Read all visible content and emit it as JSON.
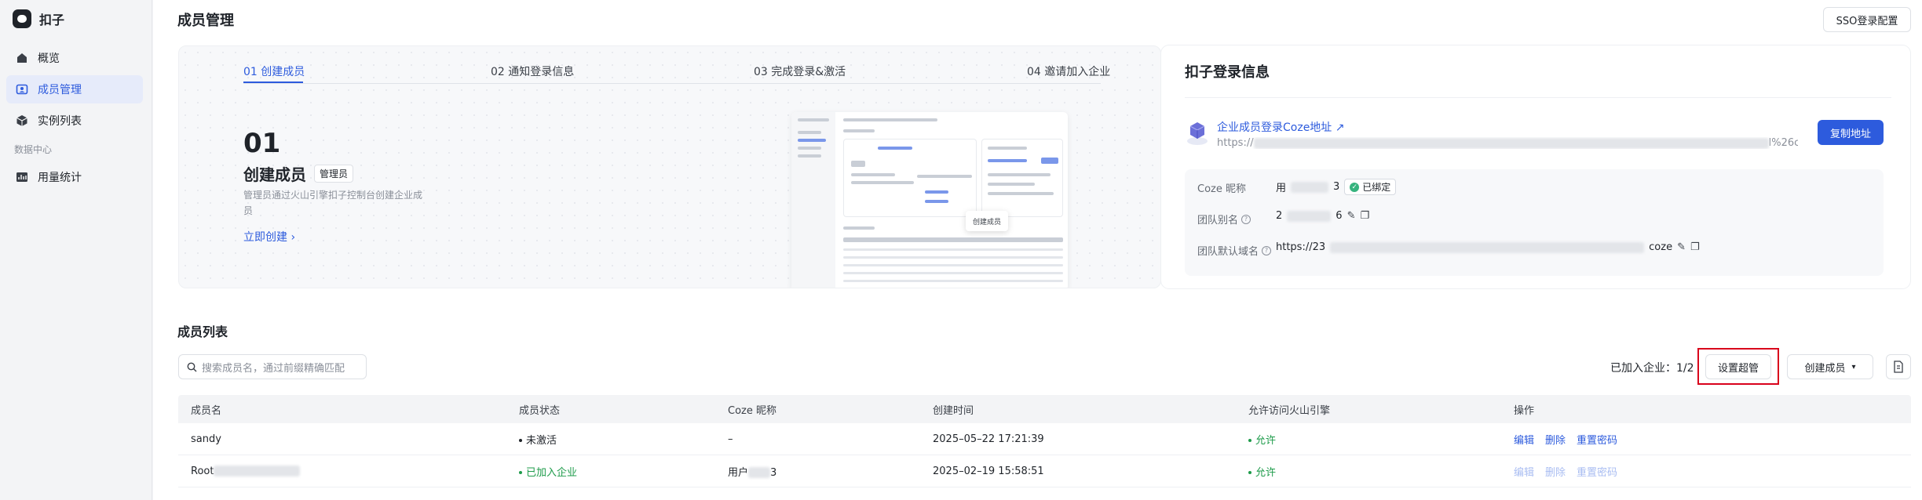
{
  "app": {
    "name": "扣子"
  },
  "sidebar": {
    "items": [
      {
        "label": "概览",
        "icon": "home-icon"
      },
      {
        "label": "成员管理",
        "icon": "member-icon"
      },
      {
        "label": "实例列表",
        "icon": "cube-icon"
      }
    ],
    "group_label": "数据中心",
    "group_items": [
      {
        "label": "用量统计",
        "icon": "chart-icon"
      }
    ]
  },
  "header": {
    "title": "成员管理",
    "sso_button": "SSO登录配置"
  },
  "steps": {
    "tabs": [
      "01 创建成员",
      "02 通知登录信息",
      "03 完成登录&激活",
      "04 邀请加入企业"
    ],
    "active_number": "01",
    "active_title": "创建成员",
    "active_badge": "管理员",
    "active_desc": "管理员通过火山引擎扣子控制台创建企业成员",
    "action": "立即创建 ›",
    "mock_popup": "创建成员"
  },
  "login_info": {
    "title": "扣子登录信息",
    "link_title": "企业成员登录Coze地址 ↗",
    "link_url_prefix": "https://",
    "link_url_suffix": "l%26c...",
    "copy_button": "复制地址",
    "coze_nickname_label": "Coze 昵称",
    "coze_nickname_prefix": "用",
    "coze_nickname_suffix": "3",
    "bound_badge": "已绑定",
    "team_alias_label": "团队别名",
    "team_alias_prefix": "2",
    "team_alias_suffix": "6",
    "domain_label": "团队默认域名",
    "domain_prefix": "https://23",
    "domain_suffix": "coze"
  },
  "members": {
    "title": "成员列表",
    "search_placeholder": "搜索成员名，通过前缀精确匹配",
    "joined_text": "已加入企业：1/2",
    "super_admin_button": "设置超管",
    "create_button": "创建成员",
    "columns": [
      "成员名",
      "成员状态",
      "Coze 昵称",
      "创建时间",
      "允许访问火山引擎",
      "操作"
    ],
    "rows": [
      {
        "name": "sandy",
        "status": "未激活",
        "nickname": "–",
        "created": "2025–05–22 17:21:39",
        "access": "允许",
        "ops": [
          "编辑",
          "删除",
          "重置密码"
        ]
      },
      {
        "name": "Root",
        "status": "已加入企业",
        "nickname_prefix": "用户",
        "nickname_suffix": "3",
        "created": "2025–02–19 15:58:51",
        "access": "允许",
        "ops": [
          "编辑",
          "删除",
          "重置密码"
        ]
      }
    ]
  },
  "colors": {
    "accent": "#2d5bdd",
    "success": "#1d9b4a",
    "highlight_border": "#d9001b"
  }
}
